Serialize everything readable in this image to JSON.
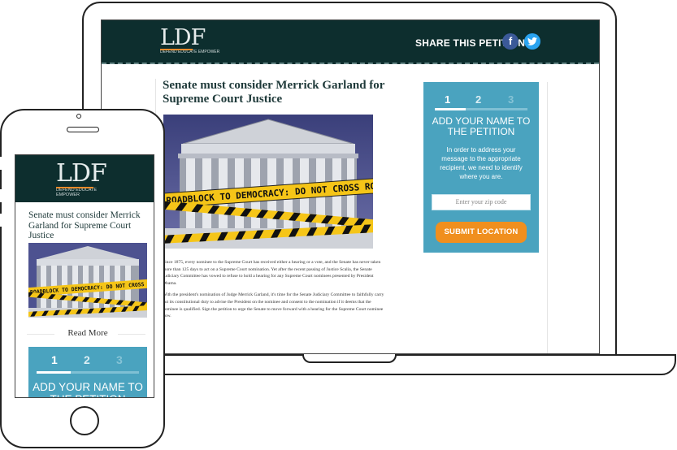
{
  "brand": {
    "logo_letters": "LDF",
    "tagline": "DEFEND  EDUCATE  EMPOWER"
  },
  "header": {
    "share_label": "SHARE THIS PETITION:",
    "facebook_icon": "f",
    "twitter_icon": "t"
  },
  "article": {
    "title": "Senate must consider Merrick Garland for Supreme Court Justice",
    "hero_tape_text": "ROADBLOCK TO DEMOCRACY: DO NOT CROSS RO",
    "paragraphs": [
      "Since 1875, every nominee to the Supreme Court has received either a hearing or a vote, and the Senate has never taken more than 125 days to act on a Supreme Court nomination. Yet after the recent passing of Justice Scalia, the Senate Judiciary Committee has vowed to refuse to hold a hearing for any Supreme Court nominees presented by President Obama.",
      "With the president's nomination of Judge Merrick Garland, it's time for the Senate Judiciary Committee to faithfully carry out its constitutional duty to advise the President on the nominee and consent to the nomination if it deems that the nominee is qualified. Sign the petition to urge the Senate to move forward with a hearing for the Supreme Court nominee now."
    ]
  },
  "petition": {
    "steps": [
      "1",
      "2",
      "3"
    ],
    "active_step": 1,
    "heading": "ADD YOUR NAME TO THE PETITION",
    "description": "In order to address your message to the appropriate recipient, we need to identify where you are.",
    "zip_placeholder": "Enter your zip code",
    "submit_label": "SUBMIT LOCATION"
  },
  "mobile": {
    "title": "Senate must consider Merrick Garland for Supreme Court Justice",
    "hero_tape_text": "ROADBLOCK TO DEMOCRACY: DO NOT CROSS RO",
    "read_more": "Read More",
    "petition_heading": "ADD YOUR NAME TO THE PETITION"
  },
  "colors": {
    "header_bg": "#0d2e2e",
    "panel_bg": "#4aa3bf",
    "button_orange": "#f08f1e",
    "tape_yellow": "#f5c518",
    "facebook": "#3b5998",
    "twitter": "#2aa3ef"
  }
}
